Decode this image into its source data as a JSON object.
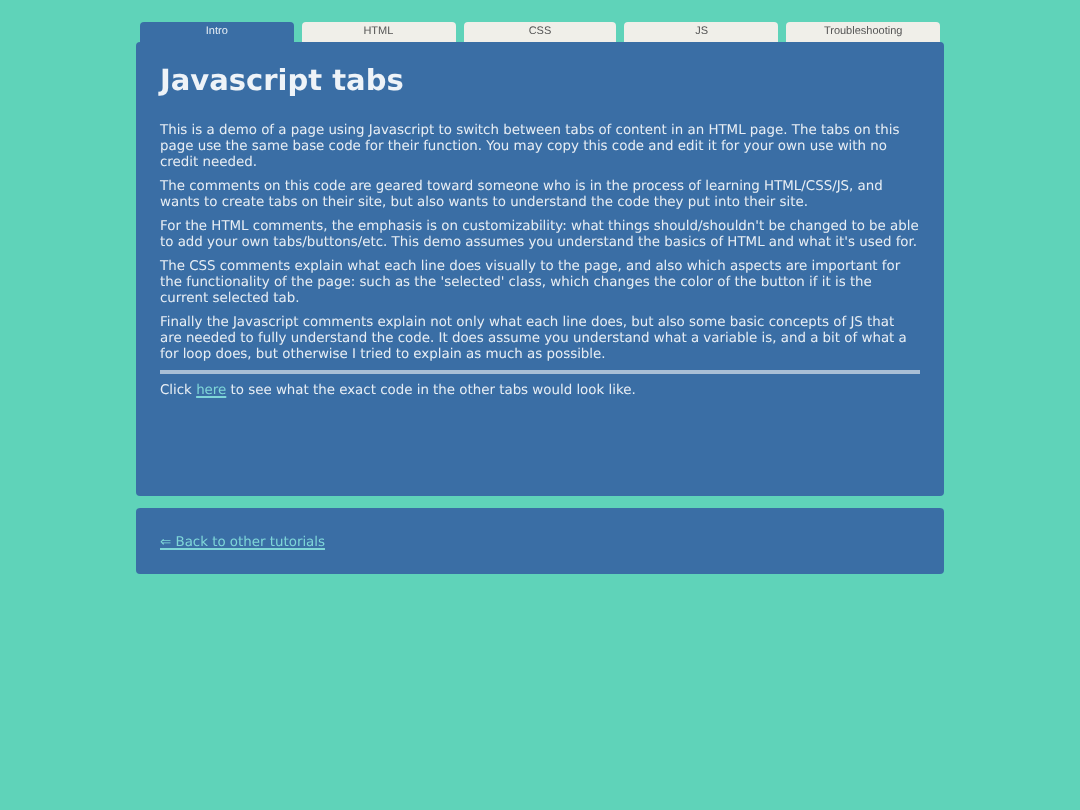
{
  "tabs": [
    {
      "label": "Intro",
      "selected": true
    },
    {
      "label": "HTML",
      "selected": false
    },
    {
      "label": "CSS",
      "selected": false
    },
    {
      "label": "JS",
      "selected": false
    },
    {
      "label": "Troubleshooting",
      "selected": false
    }
  ],
  "content": {
    "title": "Javascript tabs",
    "paragraphs": [
      "This is a demo of a page using Javascript to switch between tabs of content in an HTML page. The tabs on this page use the same base code for their function. You may copy this code and edit it for your own use with no credit needed.",
      "The comments on this code are geared toward someone who is in the process of learning HTML/CSS/JS, and wants to create tabs on their site, but also wants to understand the code they put into their site.",
      "For the HTML comments, the emphasis is on customizability: what things should/shouldn't be changed to be able to add your own tabs/buttons/etc. This demo assumes you understand the basics of HTML and what it's used for.",
      "The CSS comments explain what each line does visually to the page, and also which aspects are important for the functionality of the page: such as the 'selected' class, which changes the color of the button if it is the current selected tab.",
      "Finally the Javascript comments explain not only what each line does, but also some basic concepts of JS that are needed to fully understand the code. It does assume you understand what a variable is, and a bit of what a for loop does, but otherwise I tried to explain as much as possible."
    ],
    "note": {
      "before": "Click ",
      "link": "here",
      "after": " to see what the exact code in the other tabs would look like."
    }
  },
  "footer": {
    "link": "⇐ Back to other tutorials"
  }
}
